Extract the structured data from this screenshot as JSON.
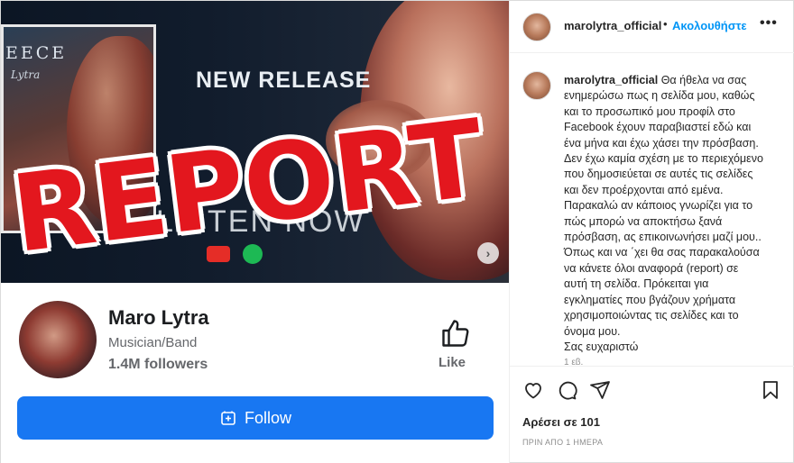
{
  "banner": {
    "album_title": "EECE",
    "album_script": "Lytra",
    "headline": "NEW RELEASE",
    "cta": "LISTEN NOW",
    "next_arrow": "›"
  },
  "overlay": {
    "stamp": "REPORT",
    "color": "#e3171e"
  },
  "facebook_card": {
    "name": "Maro Lytra",
    "category": "Musician/Band",
    "followers": "1.4M followers",
    "like_label": "Like",
    "follow_label": "Follow",
    "follow_color": "#1877f2"
  },
  "post": {
    "username": "marolytra_official",
    "dot": "•",
    "follow_label": "Ακολουθήστε",
    "more_icon": "more-horizontal-icon",
    "caption_lines": [
      "Θα ήθελα να σας",
      "ενημερώσω πως η σελίδα μου, καθώς",
      "και το προσωπικό μου προφίλ στο",
      "Facebook έχουν παραβιαστεί εδώ και",
      "ένα μήνα και έχω χάσει την πρόσβαση.",
      "Δεν έχω καμία σχέση με το περιεχόμενο",
      "που δημοσιεύεται σε αυτές τις σελίδες",
      "και δεν προέρχονται από εμένα.",
      "Παρακαλώ αν κάποιος γνωρίζει για το",
      "πώς μπορώ να αποκτήσω ξανά",
      "πρόσβαση, ας επικοινωνήσει μαζί μου..",
      "Όπως και να ΄χει θα σας παρακαλούσα",
      "να κάνετε όλοι αναφορά (report) σε",
      "αυτή τη σελίδα. Πρόκειται για",
      "εγκληματίες που βγάζουν χρήματα",
      "χρησιμοποιώντας τις σελίδες και το",
      "όνομα μου.",
      "Σας ευχαριστώ"
    ],
    "caption_age": "1 εβ.",
    "likes": "Αρέσει σε 101",
    "posted": "ΠΡΙΝ ΑΠΟ 1 ΗΜΕΡΑ",
    "accent": "#0095f6"
  }
}
